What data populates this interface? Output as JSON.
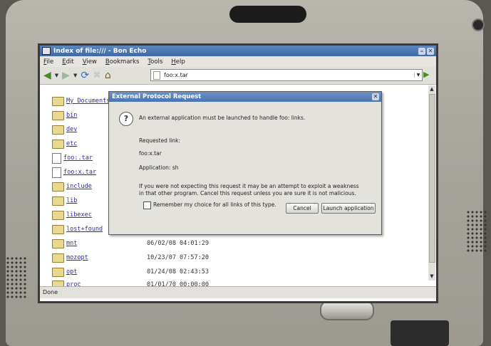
{
  "window": {
    "title": "Index of file:/// - Bon Echo",
    "minimize_glyph": "–",
    "close_glyph": "✕"
  },
  "menubar": [
    "File",
    "Edit",
    "View",
    "Bookmarks",
    "Tools",
    "Help"
  ],
  "toolbar": {
    "back_icon": "back-arrow-icon",
    "forward_icon": "forward-arrow-icon",
    "reload_icon": "reload-icon",
    "stop_icon": "stop-icon",
    "home_icon": "home-icon",
    "url": "foo:x.tar"
  },
  "files": [
    {
      "name": "My Documents",
      "kind": "folder",
      "date": ""
    },
    {
      "name": "bin",
      "kind": "folder",
      "date": ""
    },
    {
      "name": "dev",
      "kind": "folder",
      "date": ""
    },
    {
      "name": "etc",
      "kind": "folder",
      "date": ""
    },
    {
      "name": "foo:.tar",
      "kind": "file",
      "date": ""
    },
    {
      "name": "foo:x.tar",
      "kind": "file",
      "date": ""
    },
    {
      "name": "include",
      "kind": "folder",
      "date": ""
    },
    {
      "name": "lib",
      "kind": "folder",
      "date": ""
    },
    {
      "name": "libexec",
      "kind": "folder",
      "date": ""
    },
    {
      "name": "lost+found",
      "kind": "folder",
      "date": ""
    },
    {
      "name": "mnt",
      "kind": "folder",
      "date": "06/02/08 04:01:29"
    },
    {
      "name": "mozopt",
      "kind": "folder",
      "date": "10/23/07 07:57:20"
    },
    {
      "name": "opt",
      "kind": "folder",
      "date": "01/24/08 02:43:53"
    },
    {
      "name": "proc",
      "kind": "folder",
      "date": "01/01/70 00:00:00"
    }
  ],
  "status": "Done",
  "dialog": {
    "title": "External Protocol Request",
    "message": "An external application must be launched to handle foo: links.",
    "requested_link_label": "Requested link:",
    "requested_link": "foo:x.tar",
    "application": "Application: sh",
    "warning_line1": "If you were not expecting this request it may be an attempt to exploit a weakness",
    "warning_line2": "in that other program. Cancel this request unless you are sure it is not malicious.",
    "remember_label": "Remember my choice for all links of this type.",
    "cancel_label": "Cancel",
    "launch_label": "Launch application",
    "close_glyph": "✕"
  }
}
